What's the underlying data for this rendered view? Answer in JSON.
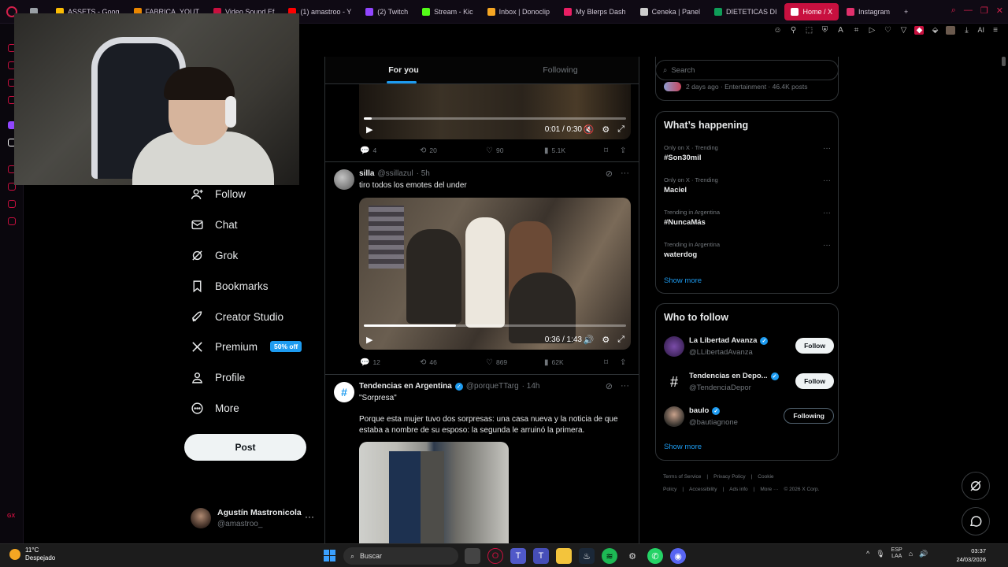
{
  "browser": {
    "tabs": [
      {
        "label": "",
        "color": "#9aa0a6"
      },
      {
        "label": "ASSETS - Goog",
        "color": "#fbbc04"
      },
      {
        "label": "FABRICA_YOUT",
        "color": "#ea8600"
      },
      {
        "label": "Video Sound Ef",
        "color": "#c8103f"
      },
      {
        "label": "(1) amastroo - Y",
        "color": "#ff0000"
      },
      {
        "label": "(2) Twitch",
        "color": "#9146ff"
      },
      {
        "label": "Stream - Kic",
        "color": "#53fc18"
      },
      {
        "label": "Inbox | Donoclip",
        "color": "#f5a623"
      },
      {
        "label": "My Blerps Dash",
        "color": "#e91e63"
      },
      {
        "label": "Ceneka | Panel",
        "color": "#cccccc"
      },
      {
        "label": "DIETETICAS DI",
        "color": "#0f9d58"
      },
      {
        "label": "Home / X",
        "color": "#ffffff",
        "active": true
      },
      {
        "label": "Instagram",
        "color": "#e1306c"
      }
    ],
    "toolbar_ai": "AI"
  },
  "nav": {
    "follow": "Follow",
    "chat": "Chat",
    "grok": "Grok",
    "bookmarks": "Bookmarks",
    "creator_studio": "Creator Studio",
    "premium": "Premium",
    "premium_badge": "50% off",
    "profile": "Profile",
    "more": "More",
    "post": "Post"
  },
  "account": {
    "name": "Agustín Mastronicola",
    "handle": "@amastroo_"
  },
  "feed": {
    "tab_for_you": "For you",
    "tab_following": "Following",
    "video1": {
      "time": "0:01 / 0:30",
      "progress": 0.03
    },
    "tweet1_stats": {
      "replies": "4",
      "reposts": "20",
      "likes": "90",
      "views": "5.1K"
    },
    "tweet2": {
      "name": "silla",
      "handle": "@ssillazul",
      "time": "· 5h",
      "text": "tiro todos los emotes del under",
      "video_time": "0:36 / 1:43",
      "video_progress": 0.35,
      "stats": {
        "replies": "12",
        "reposts": "46",
        "likes": "869",
        "views": "62K"
      }
    },
    "tweet3": {
      "name": "Tendencias en Argentina",
      "handle": "@porqueTTarg",
      "time": "· 14h",
      "text1": "\"Sorpresa\"",
      "text2": "Porque esta mujer tuvo dos sorpresas: una casa nueva y la noticia de que estaba a nombre de su esposo: la segunda le arruinó la primera."
    }
  },
  "right": {
    "search_placeholder": "Search",
    "prev_trend_meta": "2 days ago · Entertainment · 46.4K posts",
    "whats_happening": "What’s happening",
    "trends": [
      {
        "context": "Only on X · Trending",
        "title": "#Son30mil"
      },
      {
        "context": "Only on X · Trending",
        "title": "Maciel"
      },
      {
        "context": "Trending in Argentina",
        "title": "#NuncaMás"
      },
      {
        "context": "Trending in Argentina",
        "title": "waterdog"
      }
    ],
    "show_more": "Show more",
    "who_to_follow": "Who to follow",
    "suggestions": [
      {
        "name": "La Libertad Avanza",
        "handle": "@LLibertadAvanza",
        "button": "Follow"
      },
      {
        "name": "Tendencias en Depo...",
        "handle": "@TendenciaDepor",
        "button": "Follow"
      },
      {
        "name": "baulo",
        "handle": "@bautiagnone",
        "button": "Following"
      }
    ],
    "show_more2": "Show more",
    "footer": [
      "Terms of Service",
      "|",
      "Privacy Policy",
      "|",
      "Cookie Policy",
      "|",
      "Accessibility",
      "|",
      "Ads info",
      "|",
      "More ···",
      "© 2026 X Corp."
    ]
  },
  "taskbar": {
    "temp": "11°C",
    "weather": "Despejado",
    "search": "Buscar",
    "lang1": "ESP",
    "lang2": "LAA",
    "time": "03:37",
    "date": "24/03/2026"
  }
}
